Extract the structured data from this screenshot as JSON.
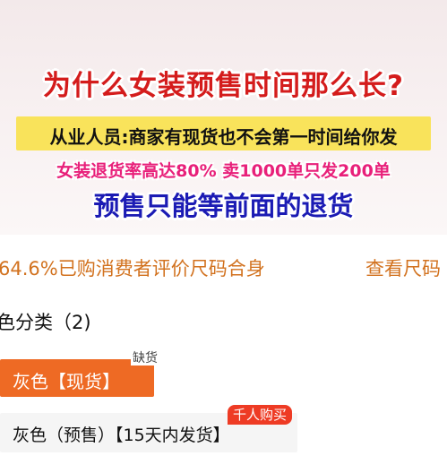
{
  "headline": {
    "title": "为什么女装预售时间那么长?",
    "subtitle": "从业人员:商家有现货也不会第一时间给你发",
    "stat": "女装退货率高达80% 卖1000单只发200单",
    "conclusion": "预售只能等前面的退货"
  },
  "review": {
    "fit_text": "64.6%已购消费者评价尺码合身",
    "size_link": "查看尺码"
  },
  "category": {
    "header": "色分类（2)"
  },
  "options": [
    {
      "label": "灰色【现货】",
      "badge": "缺货",
      "selected": true
    },
    {
      "label": "灰色（预售）【15天内发货】",
      "badge": "千人购买",
      "selected": false
    }
  ],
  "colors": {
    "accent": "#ee6a24",
    "title_red": "#d41c1c",
    "title_blue": "#1b1bb4",
    "stat_pink": "#e8207a",
    "highlight_yellow": "#f9e35b",
    "hot_badge": "#ee3b24"
  }
}
